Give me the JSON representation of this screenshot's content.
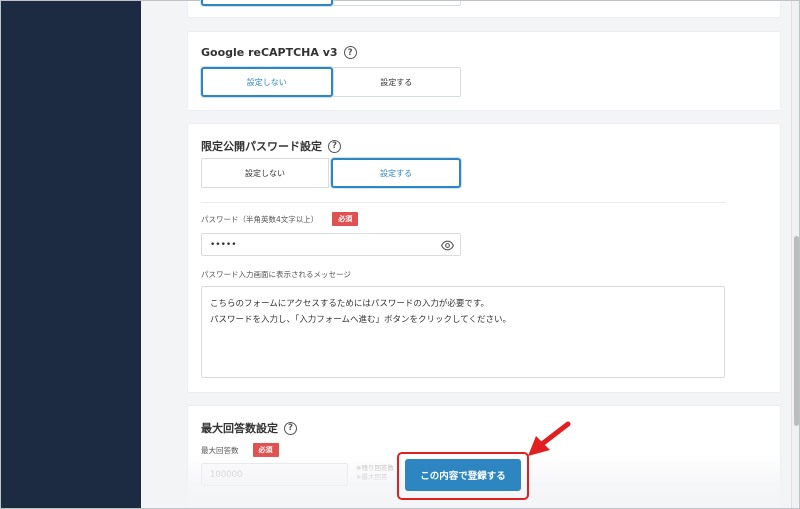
{
  "recaptcha": {
    "title": "Google reCAPTCHA v3",
    "options": [
      "設定しない",
      "設定する"
    ],
    "selected": "設定しない"
  },
  "limited_password": {
    "title": "限定公開パスワード設定",
    "options": [
      "設定しない",
      "設定する"
    ],
    "selected": "設定する",
    "password_label": "パスワード（半角英数4文字以上）",
    "required_badge": "必須",
    "password_value": "•••••",
    "message_label": "パスワード入力画面に表示されるメッセージ",
    "message_line1": "こちらのフォームにアクセスするためにはパスワードの入力が必要です。",
    "message_line2": "パスワードを入力し、「入力フォームへ進む」ボタンをクリックしてください。"
  },
  "max_answers": {
    "title": "最大回答数設定",
    "field_label": "最大回答数",
    "required_badge": "必須",
    "value": "100000",
    "note_line1": "※残り回答数",
    "note_line2": "※最大回答"
  },
  "submit": {
    "label": "この内容で登録する"
  },
  "icons": {
    "help": "question-circle-icon",
    "eye": "eye-icon",
    "arrow": "red-arrow-icon"
  },
  "colors": {
    "accent": "#2e86c1",
    "required": "#e05252",
    "sidebar": "#1c2b42",
    "highlight": "#e02020"
  }
}
